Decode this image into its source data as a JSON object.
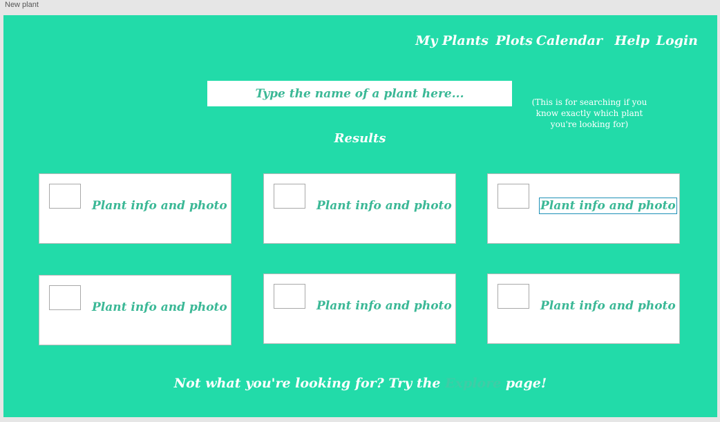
{
  "window": {
    "title": "New plant"
  },
  "nav": {
    "items": [
      {
        "label": "My Plants"
      },
      {
        "label": "Plots"
      },
      {
        "label": "Calendar"
      },
      {
        "label": "Help"
      },
      {
        "label": "Login"
      }
    ]
  },
  "search": {
    "placeholder": "Type the name of a plant here...",
    "note": "(This is for searching if you know exactly which plant you're looking for)"
  },
  "results": {
    "heading": "Results",
    "cards": [
      {
        "label": "Plant info and photo",
        "selected": false
      },
      {
        "label": "Plant info and photo",
        "selected": false
      },
      {
        "label": "Plant info and photo",
        "selected": true
      },
      {
        "label": "Plant info and photo",
        "selected": false
      },
      {
        "label": "Plant info and photo",
        "selected": false
      },
      {
        "label": "Plant info and photo",
        "selected": false
      }
    ]
  },
  "footer": {
    "prefix": "Not what you're looking for? Try the",
    "link": "Explore",
    "suffix": "page!"
  },
  "colors": {
    "background": "#22dba9",
    "accent_text": "#3bb896",
    "selection": "#1c8fb6"
  }
}
